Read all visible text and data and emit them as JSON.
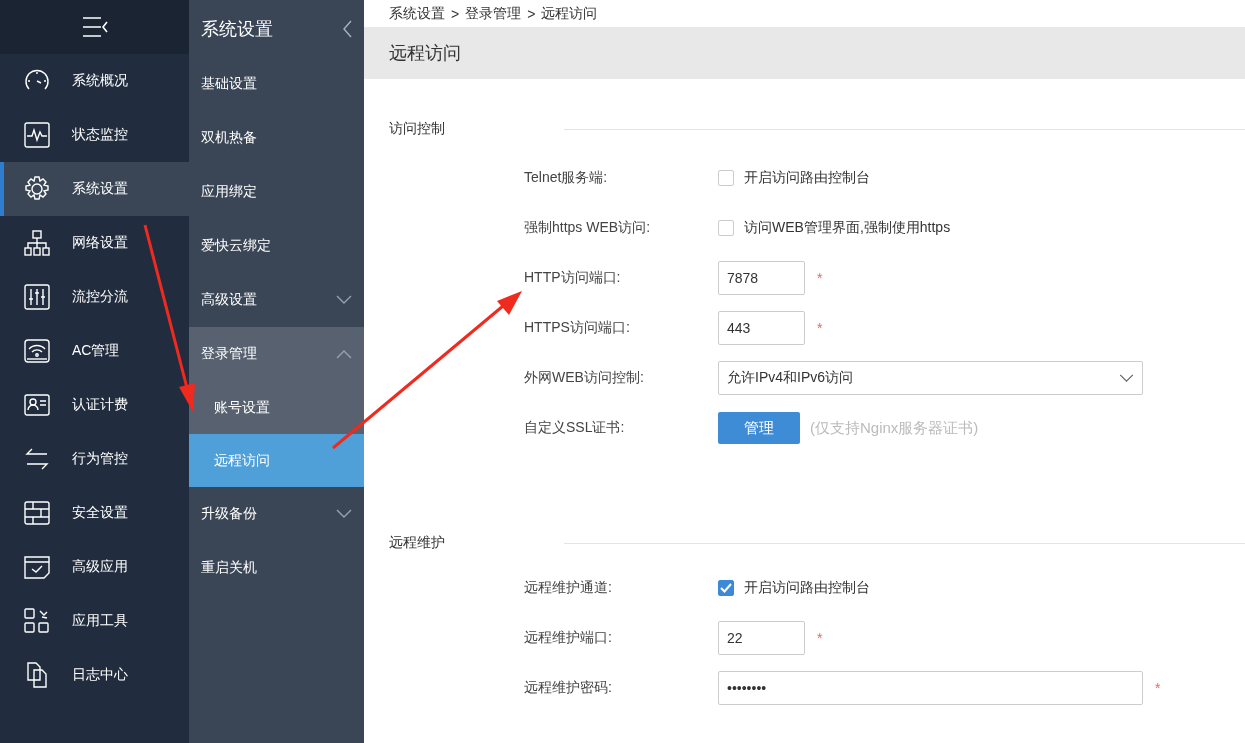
{
  "nav_rail": {
    "items": [
      {
        "label": "系统概况",
        "selected": false
      },
      {
        "label": "状态监控",
        "selected": false
      },
      {
        "label": "系统设置",
        "selected": true
      },
      {
        "label": "网络设置",
        "selected": false
      },
      {
        "label": "流控分流",
        "selected": false
      },
      {
        "label": "AC管理",
        "selected": false
      },
      {
        "label": "认证计费",
        "selected": false
      },
      {
        "label": "行为管控",
        "selected": false
      },
      {
        "label": "安全设置",
        "selected": false
      },
      {
        "label": "高级应用",
        "selected": false
      },
      {
        "label": "应用工具",
        "selected": false
      },
      {
        "label": "日志中心",
        "selected": false
      }
    ]
  },
  "submenu": {
    "title": "系统设置",
    "items": [
      {
        "kind": "link",
        "label": "基础设置",
        "selected": false
      },
      {
        "kind": "link",
        "label": "双机热备",
        "selected": false
      },
      {
        "kind": "link",
        "label": "应用绑定",
        "selected": false
      },
      {
        "kind": "link",
        "label": "爱快云绑定",
        "selected": false
      },
      {
        "kind": "group",
        "label": "高级设置",
        "selected": false,
        "expanded": false
      },
      {
        "kind": "group",
        "label": "登录管理",
        "selected": false,
        "expanded": true,
        "children": [
          {
            "label": "账号设置",
            "selected": false
          },
          {
            "label": "远程访问",
            "selected": true
          }
        ]
      },
      {
        "kind": "group",
        "label": "升级备份",
        "selected": false,
        "expanded": false
      },
      {
        "kind": "link",
        "label": "重启关机",
        "selected": false
      }
    ]
  },
  "breadcrumb": [
    "系统设置",
    "登录管理",
    "远程访问"
  ],
  "breadcrumb_separator": ">",
  "page_title": "远程访问",
  "sections": [
    {
      "title": "访问控制",
      "fields": [
        {
          "kind": "checkbox",
          "label": "Telnet服务端:",
          "checked": false,
          "text": "开启访问路由控制台"
        },
        {
          "kind": "checkbox",
          "label": "强制https WEB访问:",
          "checked": false,
          "text": "访问WEB管理界面,强制使用https"
        },
        {
          "kind": "input",
          "label": "HTTP访问端口:",
          "value": "7878",
          "required_mark": "*"
        },
        {
          "kind": "input",
          "label": "HTTPS访问端口:",
          "value": "443",
          "required_mark": "*"
        },
        {
          "kind": "select",
          "label": "外网WEB访问控制:",
          "value": "允许IPv4和IPv6访问"
        },
        {
          "kind": "button",
          "label": "自定义SSL证书:",
          "button": "管理",
          "note": "(仅支持Nginx服务器证书)"
        }
      ]
    },
    {
      "title": "远程维护",
      "fields": [
        {
          "kind": "checkbox",
          "label": "远程维护通道:",
          "checked": true,
          "text": "开启访问路由控制台"
        },
        {
          "kind": "input",
          "label": "远程维护端口:",
          "value": "22",
          "required_mark": "*"
        },
        {
          "kind": "password",
          "label": "远程维护密码:",
          "value": "••••••••",
          "required_mark": "*"
        }
      ]
    }
  ]
}
